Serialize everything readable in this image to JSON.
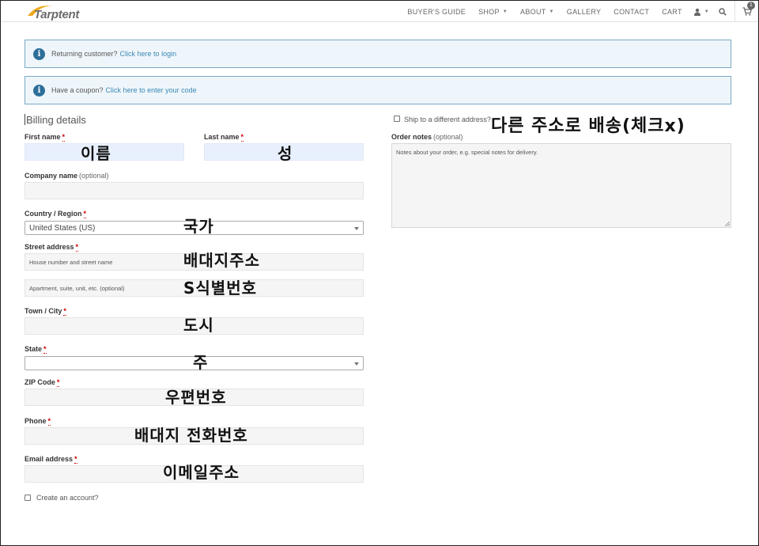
{
  "header": {
    "logo_text": "Tarptent",
    "nav": [
      {
        "label": "BUYER'S GUIDE",
        "caret": ""
      },
      {
        "label": "SHOP",
        "caret": "▼"
      },
      {
        "label": "ABOUT",
        "caret": "▼"
      },
      {
        "label": "GALLERY",
        "caret": ""
      },
      {
        "label": "CONTACT",
        "caret": ""
      },
      {
        "label": "CART",
        "caret": ""
      }
    ],
    "account_caret": "▼",
    "cart_count": "1",
    "icons": [
      "user-icon",
      "search-icon",
      "cart-icon"
    ]
  },
  "notices": {
    "login": {
      "text": "Returning customer?",
      "link": "Click here to login",
      "icon": "info-icon"
    },
    "coupon": {
      "text": "Have a coupon?",
      "link": "Click here to enter your code",
      "icon": "info-icon"
    }
  },
  "billing": {
    "title": "Billing details",
    "required_mark": "*",
    "optional_text": "(optional)",
    "first_name_label": "First name",
    "last_name_label": "Last name",
    "company_label": "Company name",
    "country_label": "Country / Region",
    "country_value": "United States (US)",
    "street_label": "Street address",
    "street_placeholder": "House number and street name",
    "apartment_placeholder": "Apartment, suite, unit, etc. (optional)",
    "city_label": "Town / City",
    "state_label": "State",
    "state_value": "",
    "zip_label": "ZIP Code",
    "phone_label": "Phone",
    "email_label": "Email address",
    "create_account": "Create an account?"
  },
  "shipping": {
    "ship_different": "Ship to a different address?",
    "order_notes_label": "Order notes",
    "order_notes_placeholder": "Notes about your order, e.g. special notes for delivery."
  },
  "annotations": {
    "ship": "다른 주소로 배송(체크x)",
    "first_name": "이름",
    "last_name": "성",
    "country": "국가",
    "street": "배대지주소",
    "apartment": "S식별번호",
    "city": "도시",
    "state": "주",
    "zip": "우편번호",
    "phone": "배대지 전화번호",
    "email": "이메일주소"
  },
  "colors": {
    "notice_border": "#7aa9c4",
    "notice_bg": "#eff6fb",
    "info_icon": "#2d6f99",
    "link": "#3b88b5",
    "required": "#cc0000",
    "logo_swoosh": "#f0a81c",
    "autofill_bg": "#e8f0fd"
  }
}
